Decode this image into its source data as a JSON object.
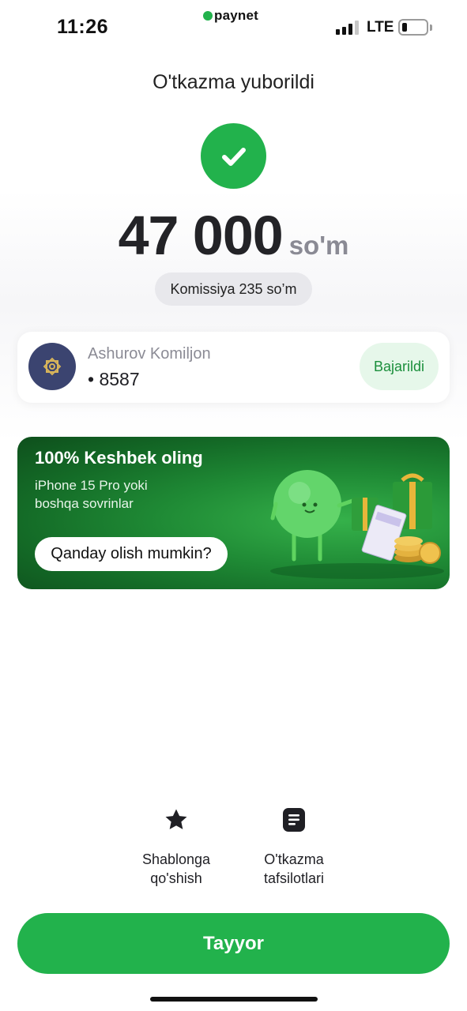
{
  "status_bar": {
    "time": "11:26",
    "brand": "paynet",
    "network": "LTE",
    "battery_level": 0.15
  },
  "screen": {
    "title": "O'tkazma yuborildi",
    "success_icon": "checkmark-icon"
  },
  "transfer": {
    "amount": "47 000",
    "currency": "so'm",
    "commission": "Komissiya 235 so’m"
  },
  "recipient": {
    "name": "Ashurov Komiljon",
    "card": "• 8587",
    "status": "Bajarildi",
    "avatar_icon": "bank-logo-icon"
  },
  "promo": {
    "title": "100% Keshbek oling",
    "subtitle": "iPhone 15 Pro yoki boshqa sovrinlar",
    "button": "Qanday olish mumkin?"
  },
  "actions": [
    {
      "label_line1": "Shablonga",
      "label_line2": "qo'shish",
      "icon": "star-icon"
    },
    {
      "label_line1": "O'tkazma",
      "label_line2": "tafsilotlari",
      "icon": "document-icon"
    }
  ],
  "primary_button": "Tayyor",
  "colors": {
    "accent": "#22b24c",
    "status_bg": "#e6f7ea",
    "status_text": "#1b8f3c",
    "avatar_bg": "#3b4470"
  }
}
